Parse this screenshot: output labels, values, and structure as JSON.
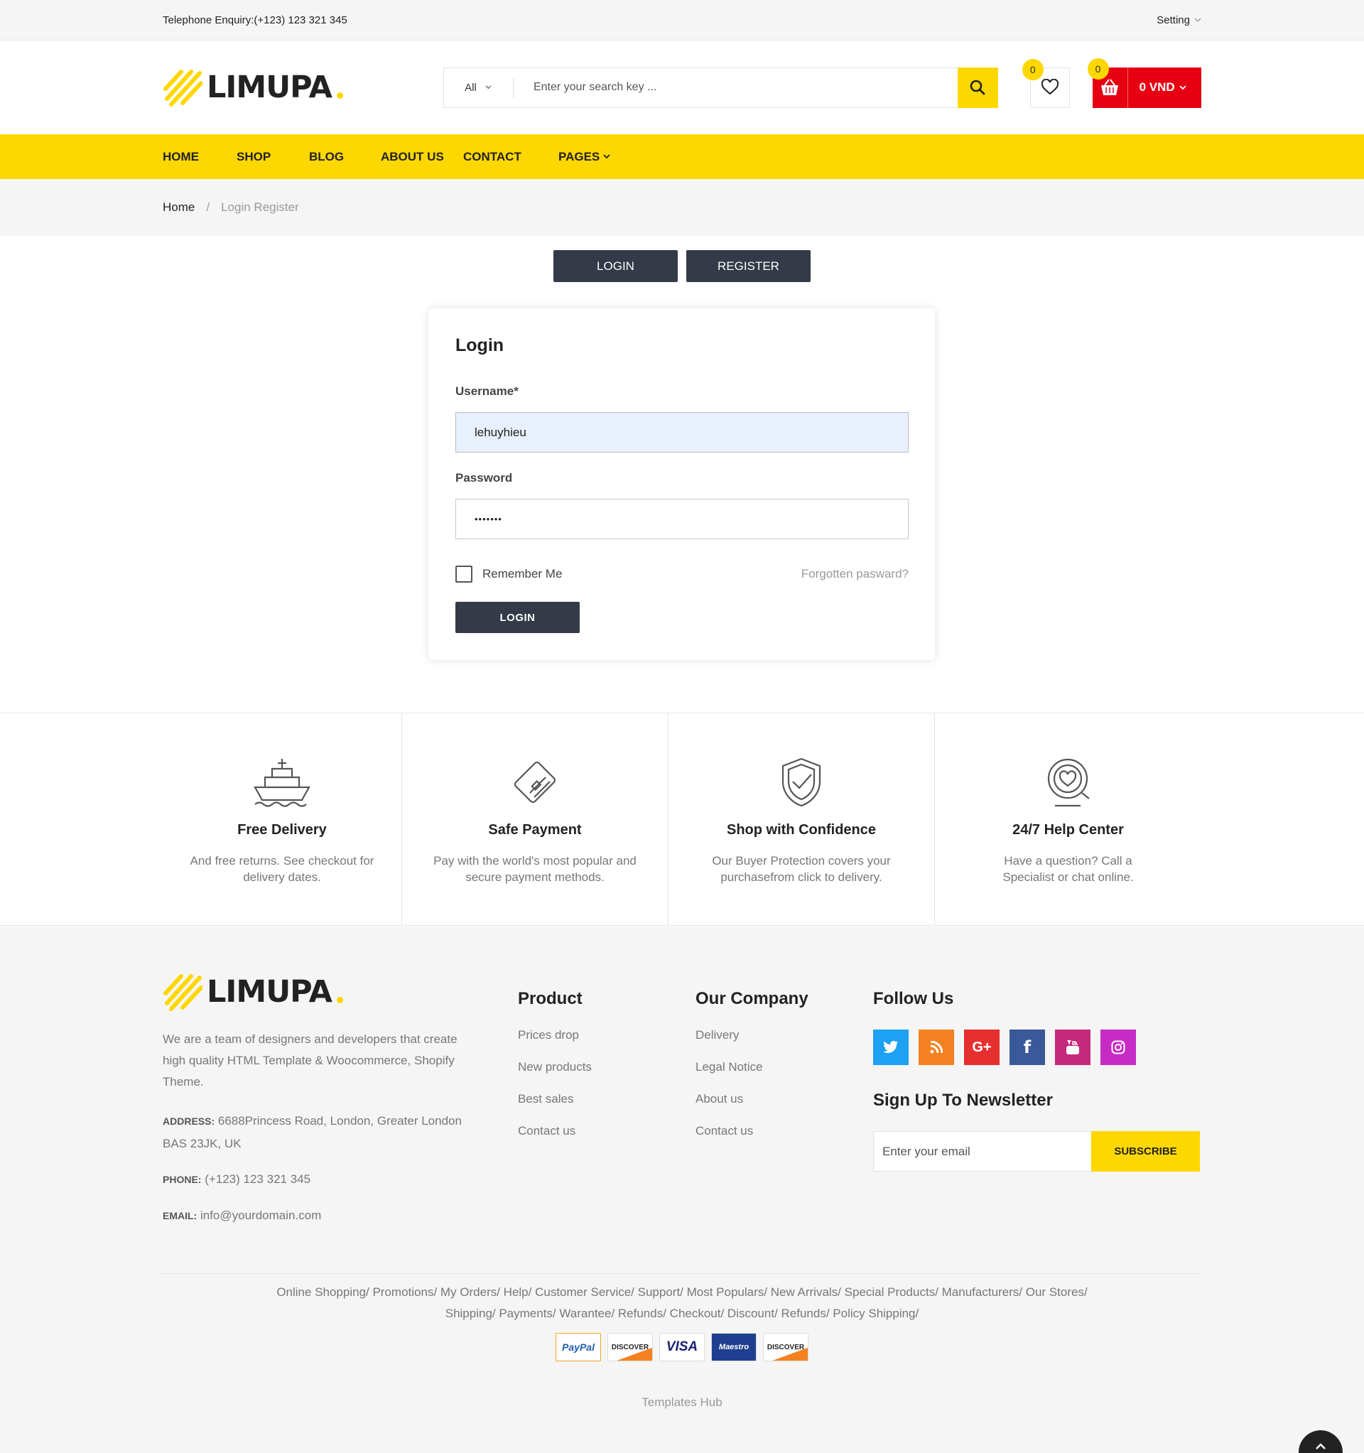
{
  "topbar": {
    "phone": "Telephone Enquiry:(+123) 123 321 345",
    "setting": "Setting"
  },
  "header": {
    "logo": "LIMUPA",
    "search": {
      "category": "All",
      "placeholder": "Enter your search key ..."
    },
    "wishlist_count": "0",
    "cart": {
      "count": "0",
      "amount": "0 VND"
    }
  },
  "nav": [
    {
      "label": "HOME"
    },
    {
      "label": "SHOP"
    },
    {
      "label": "BLOG"
    },
    {
      "label": "ABOUT US"
    },
    {
      "label": "CONTACT"
    },
    {
      "label": "PAGES"
    }
  ],
  "breadcrumb": {
    "home": "Home",
    "separator": "/",
    "current": "Login Register"
  },
  "tabs": {
    "login": "LOGIN",
    "register": "REGISTER"
  },
  "login_form": {
    "title": "Login",
    "username_label": "Username*",
    "username_value": "lehuyhieu",
    "password_label": "Password",
    "password_value": "•••••••",
    "remember": "Remember Me",
    "forgot": "Forgotten pasward?",
    "submit": "LOGIN"
  },
  "features": [
    {
      "icon": "ship-icon",
      "title": "Free Delivery",
      "text": "And free returns. See checkout for delivery dates."
    },
    {
      "icon": "credit-card-icon",
      "title": "Safe Payment",
      "text": "Pay with the world's most popular and secure payment methods."
    },
    {
      "icon": "shield-check-icon",
      "title": "Shop with Confidence",
      "text": "Our Buyer Protection covers your purchasefrom click to delivery."
    },
    {
      "icon": "help-heart-icon",
      "title": "24/7 Help Center",
      "text": "Have a question? Call a Specialist or chat online."
    }
  ],
  "footer": {
    "logo": "LIMUPA",
    "description": "We are a team of designers and developers that create high quality HTML Template & Woocommerce, Shopify Theme.",
    "address_label": "ADDRESS:",
    "address": "6688Princess Road, London, Greater London BAS 23JK, UK",
    "phone_label": "PHONE:",
    "phone": "(+123) 123 321 345",
    "email_label": "EMAIL:",
    "email": "info@yourdomain.com",
    "product": {
      "title": "Product",
      "links": [
        "Prices drop",
        "New products",
        "Best sales",
        "Contact us"
      ]
    },
    "company": {
      "title": "Our Company",
      "links": [
        "Delivery",
        "Legal Notice",
        "About us",
        "Contact us"
      ]
    },
    "follow": {
      "title": "Follow Us"
    },
    "newsletter": {
      "title": "Sign Up To Newsletter",
      "placeholder": "Enter your email",
      "button": "SUBSCRIBE"
    },
    "links_line1": "Online Shopping/ Promotions/ My Orders/ Help/ Customer Service/ Support/ Most Populars/ New Arrivals/ Special Products/ Manufacturers/ Our Stores/",
    "links_line2": "Shipping/ Payments/ Warantee/ Refunds/ Checkout/ Discount/ Refunds/ Policy Shipping/",
    "payments": [
      "PayPal",
      "DISCOVER",
      "VISA",
      "Maestro",
      "DISCOVER"
    ],
    "copyright": "Templates Hub"
  },
  "colors": {
    "accent": "#fdd700",
    "dark": "#343a48",
    "cart": "#e60012",
    "twitter": "#1da1f2",
    "rss": "#f48120",
    "google": "#e62f2f",
    "facebook": "#3b5998",
    "youtube": "#c6287b",
    "instagram": "#c62bc6"
  }
}
